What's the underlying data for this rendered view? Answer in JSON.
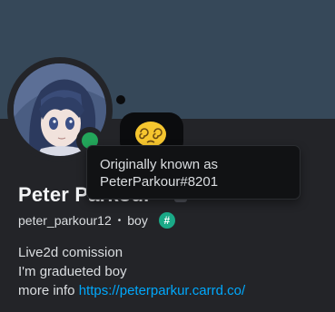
{
  "profile": {
    "display_name": "Peter Parkour",
    "username": "peter_parkour12",
    "separator": "•",
    "pronouns": "boy",
    "tag_badge": "#",
    "status_color": "#23a55a",
    "banner_color": "#364859"
  },
  "tooltip": {
    "line1": "Originally known as",
    "line2": "PeterParkour#8201"
  },
  "bio": {
    "line1": "Live2d comission",
    "line2": "I'm gradueted boy",
    "line3_prefix": "more info ",
    "link": "https://peterparkur.carrd.co/"
  },
  "icons": {
    "avatar": "anime-avatar",
    "status": "online-status-icon",
    "custom_status_emoji": "dizzy-face-emoji-icon",
    "tag_badge": "hashtag-badge-icon"
  }
}
